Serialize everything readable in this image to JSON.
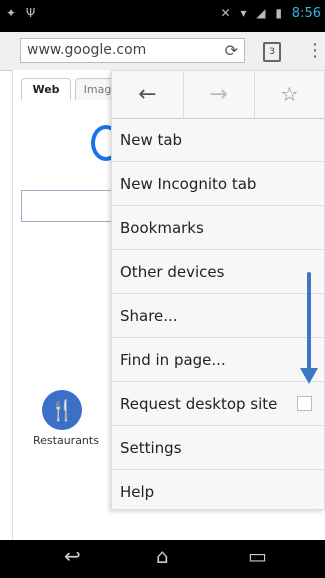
{
  "status_bar": {
    "time": "8:56"
  },
  "omnibox": {
    "url": "www.google.com",
    "tab_count": "3"
  },
  "search_tabs": {
    "web": "Web",
    "images": "Imag"
  },
  "shortcuts": {
    "restaurants_label": "Restaurants"
  },
  "menu": {
    "items": [
      {
        "label": "New tab"
      },
      {
        "label": "New Incognito tab"
      },
      {
        "label": "Bookmarks"
      },
      {
        "label": "Other devices"
      },
      {
        "label": "Share..."
      },
      {
        "label": "Find in page..."
      },
      {
        "label": "Request desktop site",
        "checked": false
      },
      {
        "label": "Settings"
      },
      {
        "label": "Help"
      }
    ]
  },
  "colors": {
    "accent_blue": "#3b78c4",
    "status_time": "#33b5e5"
  },
  "icons": {
    "back": "arrow-left",
    "forward": "arrow-right",
    "bookmark": "star",
    "reload": "refresh",
    "overflow": "vertical-dots"
  }
}
